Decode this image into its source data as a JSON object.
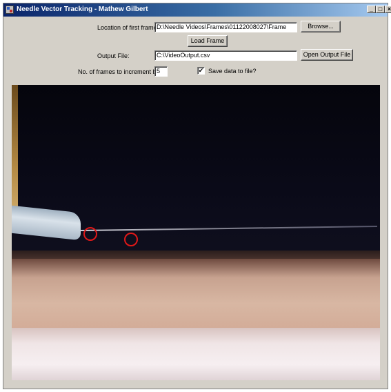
{
  "window": {
    "title": "Needle Vector Tracking - Mathew Gilbert",
    "caption_buttons": {
      "minimize": "_",
      "maximize": "□",
      "close": "×"
    }
  },
  "form": {
    "first_frame_label": "Location of first frame:",
    "first_frame_value": "D:\\Needle Videos\\Frames\\01122008027\\Frame",
    "browse_button": "Browse...",
    "load_frame_button": "Load Frame",
    "output_file_label": "Output File:",
    "output_file_value": "C:\\VideoOutput.csv",
    "open_output_button": "Open Output File",
    "increment_label": "No. of frames to increment by:",
    "increment_value": "5",
    "save_checkbox_label": "Save data to file?",
    "save_checked": true,
    "check_glyph": "✔"
  },
  "colors": {
    "marker": "#e01818",
    "window_bg": "#d4d0c8",
    "title_start": "#0a246a",
    "title_end": "#a6caf0"
  }
}
